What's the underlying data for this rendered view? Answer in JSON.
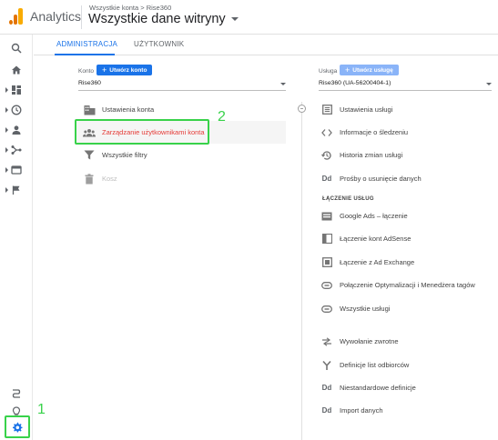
{
  "header": {
    "app_name": "Analytics",
    "breadcrumb": "Wszystkie konta > Rise360",
    "property_title": "Wszystkie dane witryny"
  },
  "tabs": [
    {
      "label": "ADMINISTRACJA",
      "active": true
    },
    {
      "label": "UŻYTKOWNIK",
      "active": false
    }
  ],
  "account": {
    "label": "Konto",
    "create_button": "Utwórz konto",
    "selected": "Rise360",
    "items": [
      {
        "label": "Ustawienia konta",
        "icon": "building-icon"
      },
      {
        "label": "Zarządzanie użytkownikami konta",
        "icon": "users-icon"
      },
      {
        "label": "Wszystkie filtry",
        "icon": "filter-icon"
      },
      {
        "label": "Kosz",
        "icon": "trash-icon"
      }
    ]
  },
  "property": {
    "label": "Usługa",
    "create_button": "Utwórz usługę",
    "selected": "Rise360 (UA-56200404-1)",
    "items": [
      {
        "label": "Ustawienia usługi",
        "icon": "settings-square-icon"
      },
      {
        "label": "Informacje o śledzeniu",
        "icon": "code-icon"
      },
      {
        "label": "Historia zmian usługi",
        "icon": "history-icon"
      },
      {
        "label": "Prośby o usunięcie danych",
        "icon": "dd-icon"
      }
    ],
    "section_heading": "ŁĄCZENIE USŁUG",
    "linking_items": [
      {
        "label": "Google Ads – łączenie",
        "icon": "ads-icon"
      },
      {
        "label": "Łączenie kont AdSense",
        "icon": "adsense-icon"
      },
      {
        "label": "Łączenie z Ad Exchange",
        "icon": "adexchange-icon"
      },
      {
        "label": "Połączenie Optymalizacji i Menedżera tagów",
        "icon": "link-icon"
      },
      {
        "label": "Wszystkie usługi",
        "icon": "link-icon"
      }
    ],
    "other_items": [
      {
        "label": "Wywołanie zwrotne",
        "icon": "postback-icon"
      },
      {
        "label": "Definicje list odbiorców",
        "icon": "audience-icon"
      },
      {
        "label": "Niestandardowe definicje",
        "icon": "dd-icon"
      },
      {
        "label": "Import danych",
        "icon": "dd-icon"
      }
    ]
  },
  "annotations": {
    "one": "1",
    "two": "2"
  },
  "colors": {
    "accent": "#1a73e8",
    "highlight_text": "#e53935",
    "annotation": "#38d24a"
  }
}
